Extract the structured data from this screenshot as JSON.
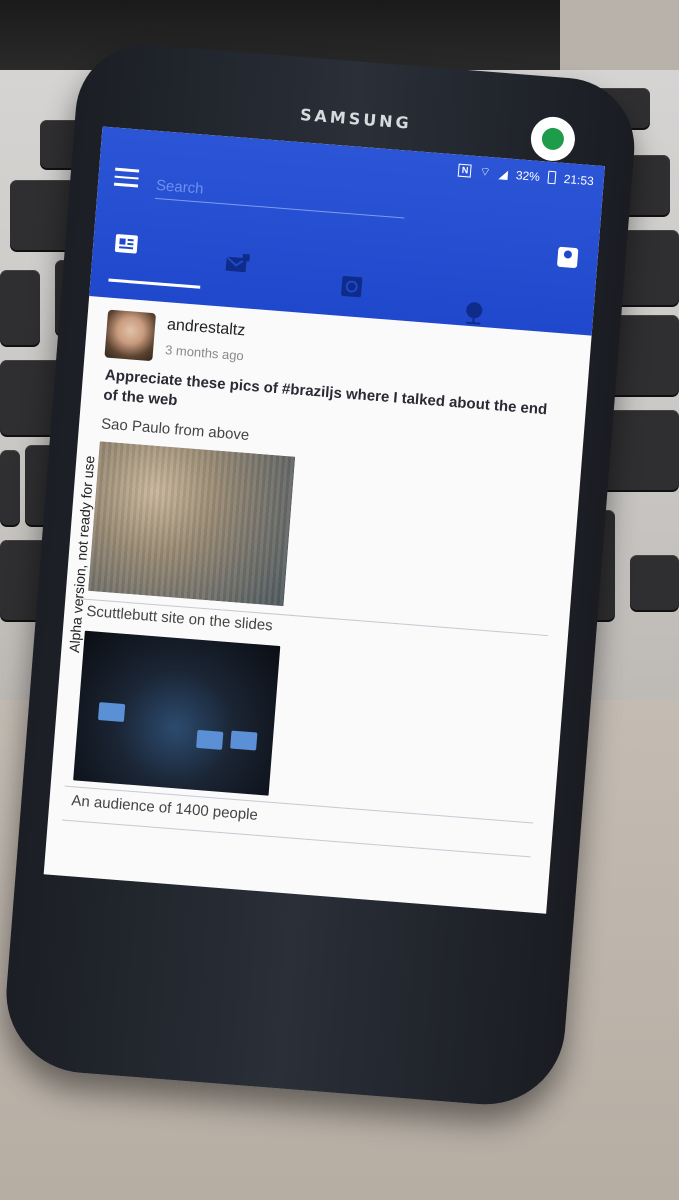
{
  "phone": {
    "brand": "SAMSUNG"
  },
  "status_bar": {
    "nfc": "N",
    "battery": "32%",
    "time": "21:53"
  },
  "app": {
    "search_placeholder": "Search",
    "tabs": [
      {
        "icon": "newspaper-icon"
      },
      {
        "icon": "private-mail-icon"
      },
      {
        "icon": "notifications-icon"
      },
      {
        "icon": "globe-icon"
      }
    ],
    "alpha_note": "Alpha version, not ready for use"
  },
  "post": {
    "author": "andrestaltz",
    "time": "3 months ago",
    "text": "Appreciate these pics of #braziljs where I talked about the end of the web",
    "captions": [
      "Sao Paulo from above",
      "Scuttlebutt site on the slides",
      "An audience of 1400 people"
    ]
  }
}
